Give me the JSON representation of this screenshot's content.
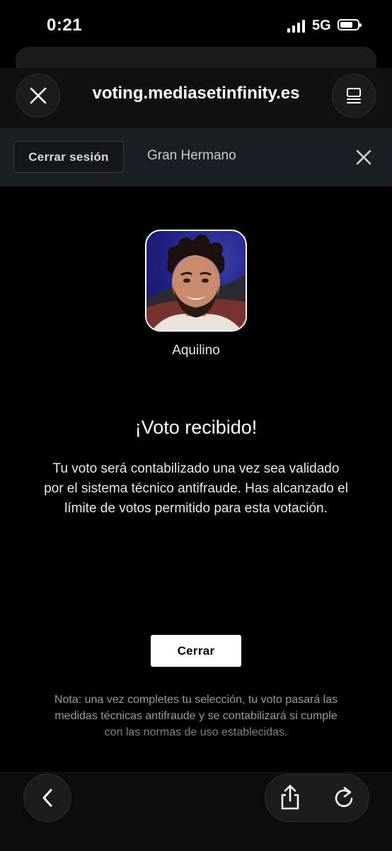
{
  "status_bar": {
    "time": "0:21",
    "network": "5G"
  },
  "browser": {
    "url": "voting.mediasetinfinity.es"
  },
  "site_nav": {
    "logout_label": "Cerrar sesión",
    "title": "Gran Hermano"
  },
  "candidate": {
    "name": "Aquilino"
  },
  "confirmation": {
    "title": "¡Voto recibido!",
    "message": "Tu voto será contabilizado una vez sea validado por el sistema técnico antifraude. Has alcanzado el límite de votos permitido para esta votación.",
    "close_label": "Cerrar"
  },
  "note": "Nota: una vez completes tu selección, tu voto pasará las medidas técnicas antifraude y se contabilizará si cumple con las normas de uso establecidas.",
  "icons": {
    "close": "close-icon",
    "tabs": "tabs-icon",
    "back": "chevron-left-icon",
    "share": "share-icon",
    "reload": "reload-icon"
  },
  "colors": {
    "background": "#000000",
    "site_bar": "#1b1e22",
    "primary_button": "#ffffff",
    "avatar_bg": "#1f2080"
  }
}
